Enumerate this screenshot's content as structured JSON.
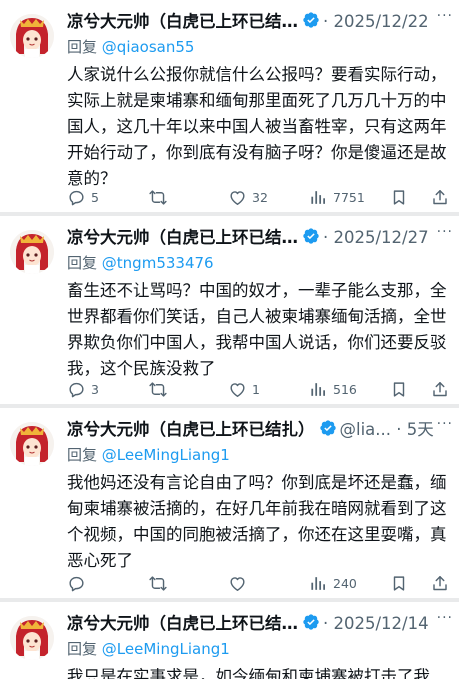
{
  "tweets": [
    {
      "name": "凉兮大元帅（白虎已上环已结…",
      "handle": "",
      "separator": "·",
      "time": "2025/12/22",
      "reply_prefix": "回复",
      "reply_to": "@qiaosan55",
      "text": "人家说什么公报你就信什么公报吗？要看实际行动，实际上就是柬埔寨和缅甸那里面死了几万几十万的中国人，这几十年以来中国人被当畜牲宰，只有这两年开始行动了，你到底有没有脑子呀？你是傻逼还是故意的？",
      "replies": "5",
      "retweets": "",
      "likes": "32",
      "views": "7751"
    },
    {
      "name": "凉兮大元帅（白虎已上环已结…",
      "handle": "",
      "separator": "·",
      "time": "2025/12/27",
      "reply_prefix": "回复",
      "reply_to": "@tngm533476",
      "text": "畜生还不让骂吗？中国的奴才，一辈子能么支那，全世界都看你们笑话，自己人被柬埔寨缅甸活摘，全世界欺负你们中国人，我帮中国人说话，你们还要反驳我，这个民族没救了",
      "replies": "3",
      "retweets": "",
      "likes": "1",
      "views": "516"
    },
    {
      "name": "凉兮大元帅（白虎已上环已结扎）",
      "handle": "@lia...",
      "separator": "·",
      "time": "5天",
      "reply_prefix": "回复",
      "reply_to": "@LeeMingLiang1",
      "text": "我他妈还没有言论自由了吗？你到底是坏还是蠢，缅甸柬埔寨被活摘的，在好几年前我在暗网就看到了这个视频，中国的同胞被活摘了，你还在这里耍嘴，真恶心死了",
      "replies": "",
      "retweets": "",
      "likes": "",
      "views": "240"
    },
    {
      "name": "凉兮大元帅（白虎已上环已结…",
      "handle": "",
      "separator": "·",
      "time": "2025/12/14",
      "reply_prefix": "回复",
      "reply_to": "@LeeMingLiang1",
      "text": "我只是在实事求是，如今缅甸和柬埔寨被打击了我",
      "replies": "",
      "retweets": "",
      "likes": "",
      "views": ""
    }
  ],
  "more_label": "···",
  "colors": {
    "link": "#1d9bf0",
    "secondary": "#536471",
    "verified": "#1d9bf0"
  }
}
